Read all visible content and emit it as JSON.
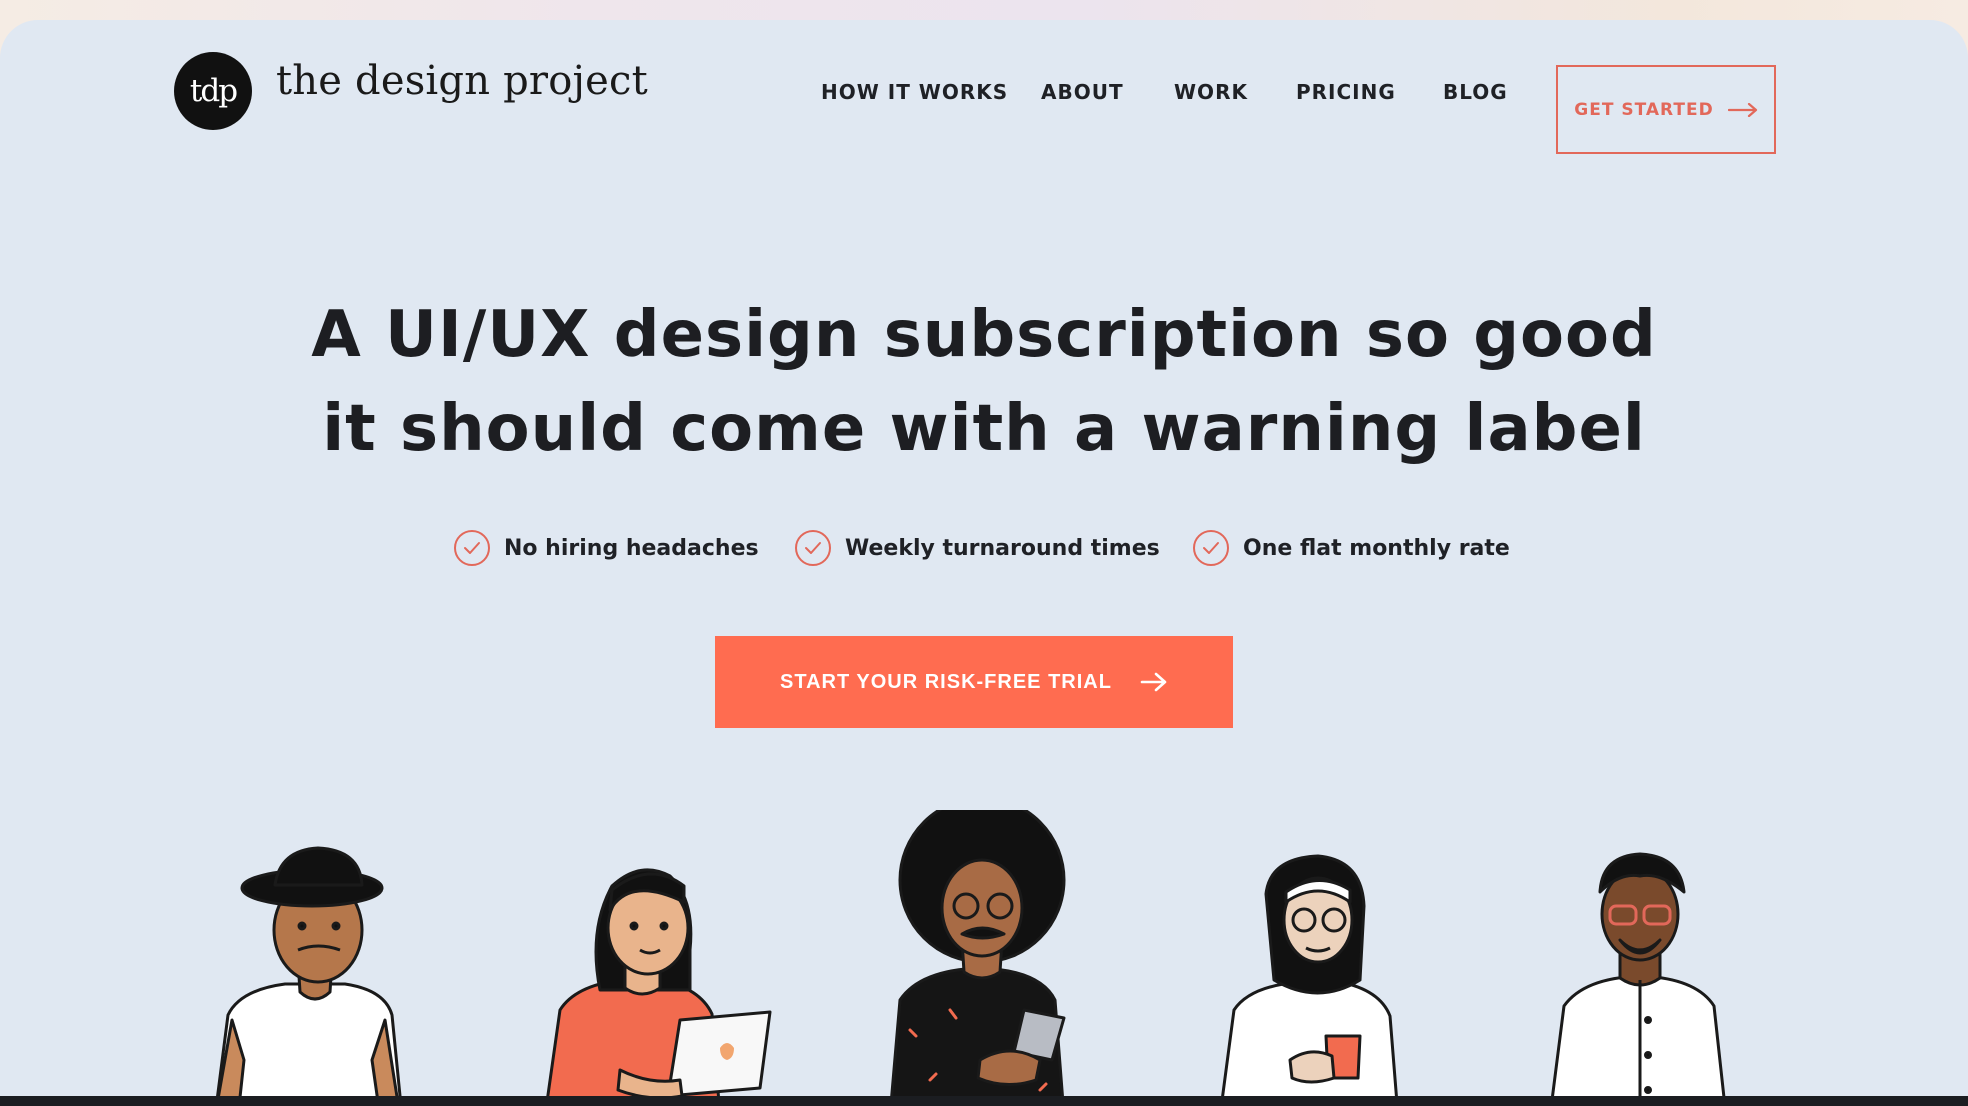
{
  "brand": {
    "logo_mark": "tdp",
    "name": "the design project"
  },
  "nav": {
    "items": [
      "HOW IT WORKS",
      "ABOUT",
      "WORK",
      "PRICING",
      "BLOG"
    ],
    "cta_label": "GET STARTED",
    "cta_icon": "arrow-right-icon"
  },
  "hero": {
    "title_line1": "A UI/UX design subscription so good",
    "title_line2": "it should come with a warning label",
    "features": [
      "No hiring headaches",
      "Weekly turnaround times",
      "One flat monthly rate"
    ],
    "feature_icon": "check-circle-icon",
    "cta_label": "START YOUR RISK-FREE TRIAL",
    "cta_icon": "arrow-right-icon"
  },
  "colors": {
    "accent": "#ff6c50",
    "accent_outline": "#e2685a",
    "page_bg": "#e0e8f2",
    "text": "#1d1e22"
  }
}
